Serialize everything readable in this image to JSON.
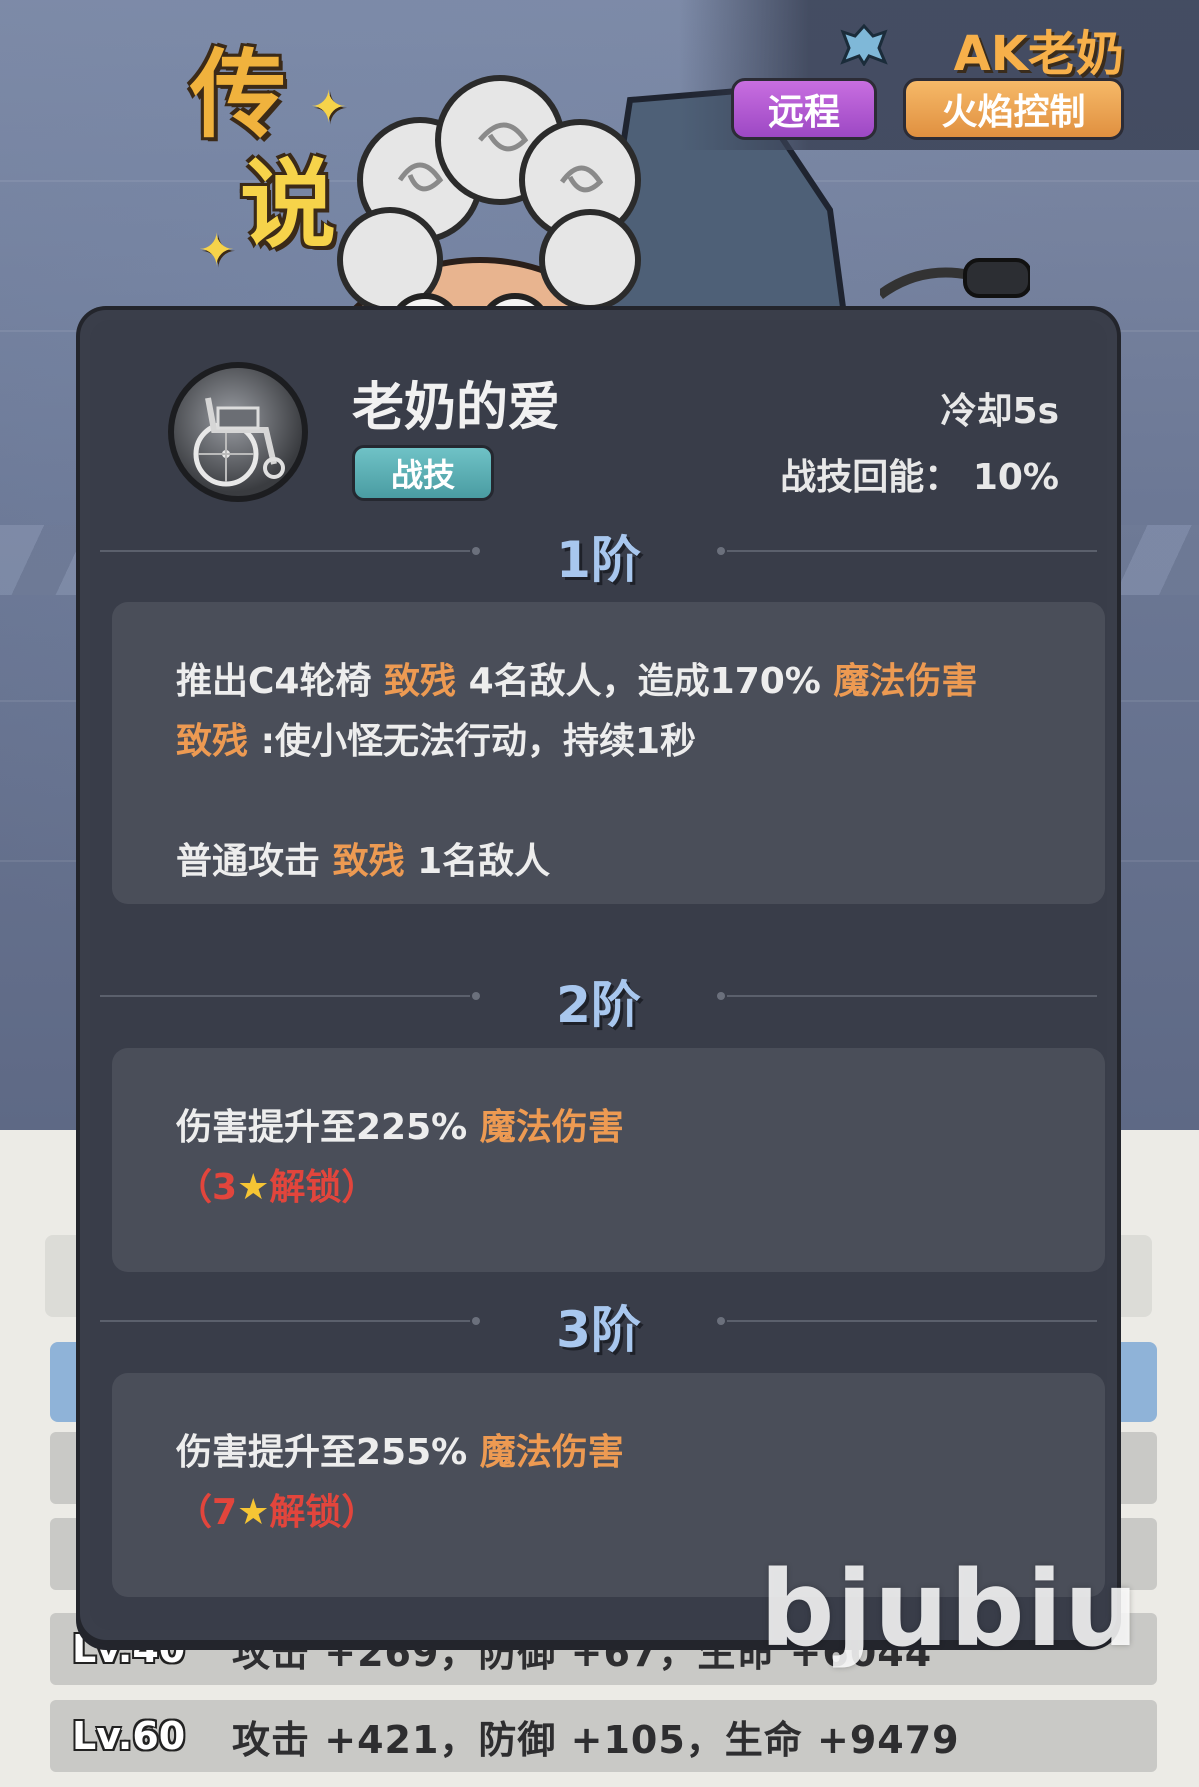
{
  "header": {
    "rarity_line1": "传",
    "rarity_line2": "说",
    "hero_name": "AK老奶",
    "tags": [
      "远程",
      "火焰控制"
    ]
  },
  "skill": {
    "name": "老奶的爱",
    "type": "战技",
    "cooldown": "冷却5s",
    "energy": "战技回能： 10%"
  },
  "tiers": [
    {
      "label": "1阶",
      "line1_a": "推出C4轮椅",
      "line1_kw1": "致残",
      "line1_b": "4名敌人，造成170%",
      "line1_kw2": "魔法伤害",
      "line2_kw": "致残",
      "line2_b": ":使小怪无法行动，持续1秒",
      "line3_a": "普通攻击",
      "line3_kw": "致残",
      "line3_b": "1名敌人"
    },
    {
      "label": "2阶",
      "line1_a": "伤害提升至225%",
      "line1_kw": "魔法伤害",
      "unlock_open": "（",
      "unlock_num": "3",
      "unlock_text": "解锁",
      "unlock_close": "）"
    },
    {
      "label": "3阶",
      "line1_a": "伤害提升至255%",
      "line1_kw": "魔法伤害",
      "unlock_open": "（",
      "unlock_num": "7",
      "unlock_text": "解锁",
      "unlock_close": "）"
    }
  ],
  "stats": [
    {
      "lv": "Lv.40",
      "text": "攻击 +269，防御 +67，生命 +6044"
    },
    {
      "lv": "Lv.60",
      "text": "攻击 +421，防御 +105，生命 +9479"
    }
  ],
  "watermark": "bjubiu",
  "colors": {
    "keyword": "#ed9a52",
    "lock": "#e2453c",
    "tier_label": "#a8c7ee",
    "modal_bg": "#3a3e4a"
  }
}
